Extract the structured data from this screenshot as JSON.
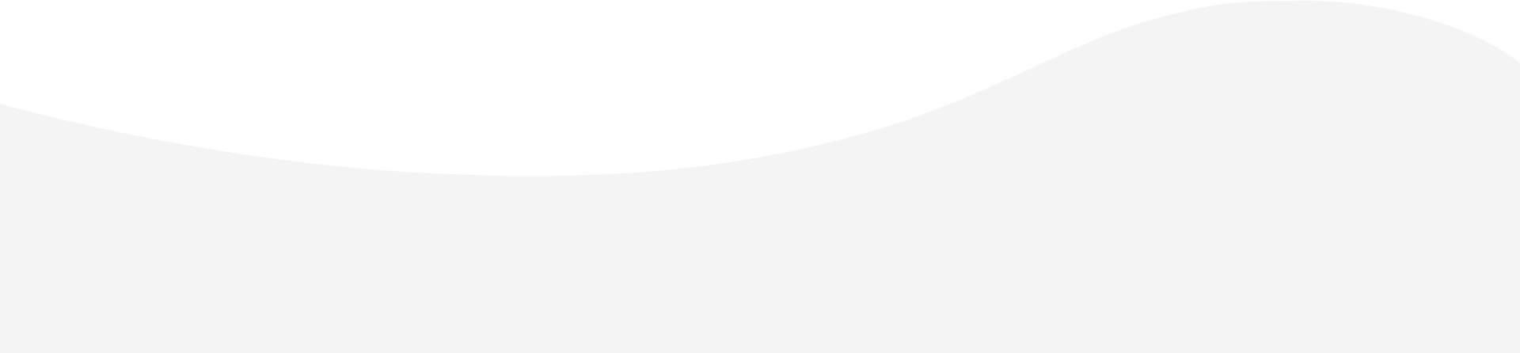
{
  "colors": {
    "background": "#ffffff",
    "wave_fill": "#f4f4f4"
  }
}
